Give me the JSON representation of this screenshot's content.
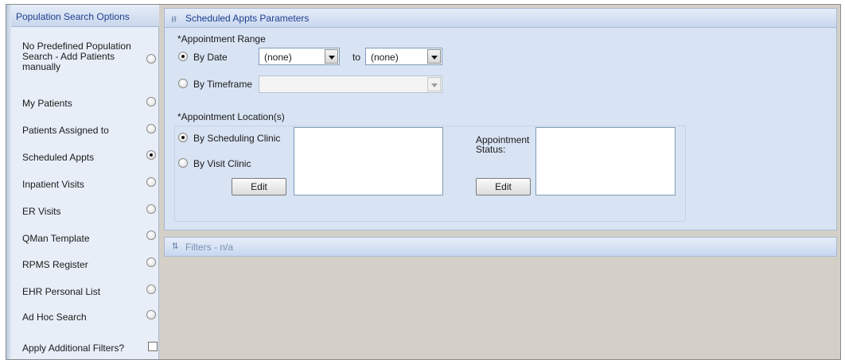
{
  "left_panel": {
    "title": "Population Search Options",
    "options": [
      {
        "label": "No Predefined Population Search - Add Patients manually",
        "selected": false
      },
      {
        "label": "My Patients",
        "selected": false
      },
      {
        "label": "Patients Assigned to",
        "selected": false
      },
      {
        "label": "Scheduled Appts",
        "selected": true
      },
      {
        "label": "Inpatient Visits",
        "selected": false
      },
      {
        "label": "ER Visits",
        "selected": false
      },
      {
        "label": "QMan Template",
        "selected": false
      },
      {
        "label": "RPMS Register",
        "selected": false
      },
      {
        "label": "EHR Personal List",
        "selected": false
      },
      {
        "label": "Ad Hoc Search",
        "selected": false
      }
    ],
    "apply_filters": {
      "label": "Apply Additional Filters?",
      "checked": false
    }
  },
  "params": {
    "header": "Scheduled Appts Parameters",
    "range": {
      "label": "*Appointment Range",
      "by_date": {
        "label": "By Date",
        "selected": true
      },
      "from_value": "(none)",
      "to_label": "to",
      "to_value": "(none)",
      "by_timeframe": {
        "label": "By Timeframe",
        "selected": false
      },
      "timeframe_value": ""
    },
    "location": {
      "label": "*Appointment Location(s)",
      "by_scheduling": {
        "label": "By Scheduling Clinic",
        "selected": true
      },
      "by_visit": {
        "label": "By Visit Clinic",
        "selected": false
      },
      "edit_label": "Edit"
    },
    "status": {
      "label": "Appointment Status:",
      "edit_label": "Edit"
    }
  },
  "filters": {
    "header": "Filters - n/a"
  },
  "icons": {
    "collapse": "chevron-up-double-icon",
    "expand": "chevron-down-double-icon"
  }
}
